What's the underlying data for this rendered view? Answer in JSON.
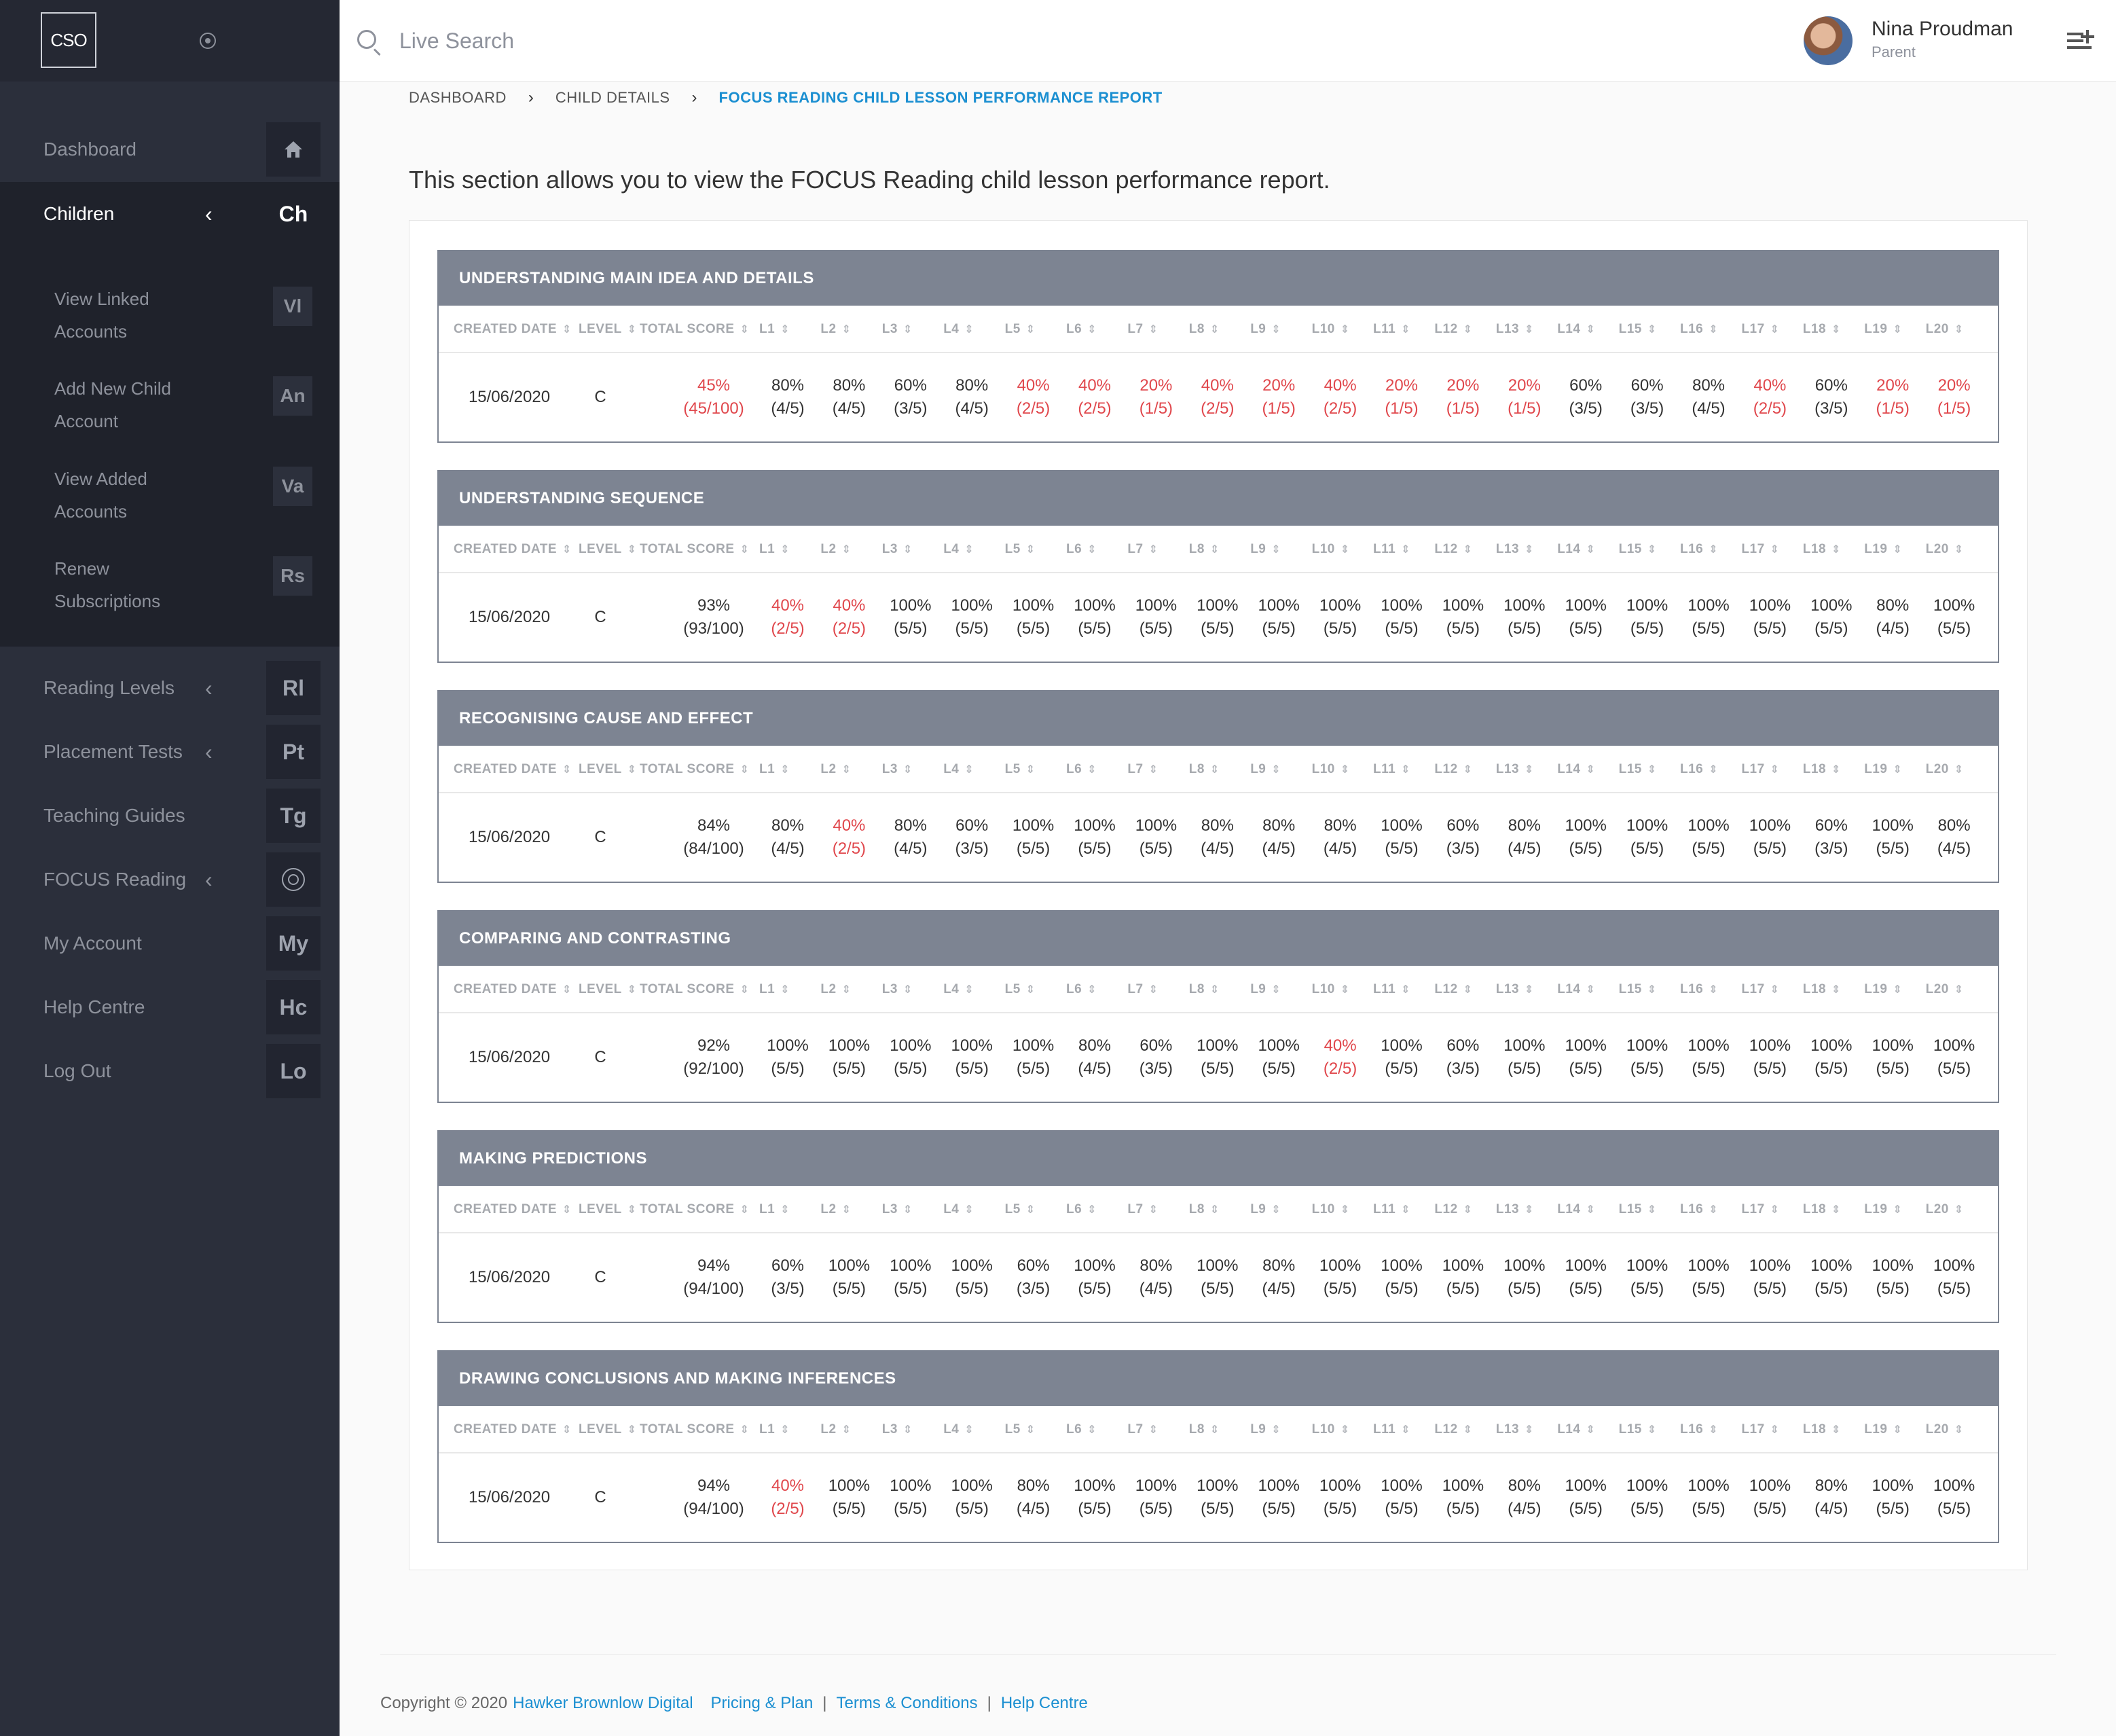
{
  "brand": {
    "logo_text": "CSO"
  },
  "icons": {
    "pin": "pin-icon",
    "search": "search-icon",
    "add": "add-user-icon",
    "target": "target-icon"
  },
  "colors": {
    "accent": "#1b8fd1",
    "low_score": "#e0474c",
    "section_header": "#7d8492",
    "sidebar": "#2b2f3b"
  },
  "sidebar": {
    "items": [
      {
        "label": "Dashboard",
        "abbr": ""
      },
      {
        "label": "Children",
        "abbr": "Ch",
        "chevron": "‹"
      },
      {
        "label": "Reading Levels",
        "abbr": "Rl",
        "chevron": "‹"
      },
      {
        "label": "Placement Tests",
        "abbr": "Pt",
        "chevron": "‹"
      },
      {
        "label": "Teaching Guides",
        "abbr": "Tg"
      },
      {
        "label": "FOCUS Reading",
        "abbr": "",
        "chevron": "‹"
      },
      {
        "label": "My Account",
        "abbr": "My"
      },
      {
        "label": "Help Centre",
        "abbr": "Hc"
      },
      {
        "label": "Log Out",
        "abbr": "Lo"
      }
    ],
    "children_sub": [
      {
        "line1": "View Linked",
        "line2": "Accounts",
        "abbr": "Vl"
      },
      {
        "line1": "Add New Child",
        "line2": "Account",
        "abbr": "An"
      },
      {
        "line1": "View Added",
        "line2": "Accounts",
        "abbr": "Va"
      },
      {
        "line1": "Renew",
        "line2": "Subscriptions",
        "abbr": "Rs"
      }
    ]
  },
  "header": {
    "search_placeholder": "Live Search",
    "user_name": "Nina Proudman",
    "user_role": "Parent"
  },
  "breadcrumb": [
    "DASHBOARD",
    "CHILD DETAILS",
    "FOCUS READING CHILD LESSON PERFORMANCE REPORT"
  ],
  "intro": "This section allows you to view the FOCUS Reading child lesson performance report.",
  "table_columns": [
    "CREATED DATE",
    "LEVEL",
    "TOTAL SCORE",
    "L1",
    "L2",
    "L3",
    "L4",
    "L5",
    "L6",
    "L7",
    "L8",
    "L9",
    "L10",
    "L11",
    "L12",
    "L13",
    "L14",
    "L15",
    "L16",
    "L17",
    "L18",
    "L19",
    "L20"
  ],
  "sections": [
    {
      "title": "UNDERSTANDING MAIN IDEA AND DETAILS",
      "date": "15/06/2020",
      "level": "C",
      "total": {
        "pct": "45%",
        "raw": "(45/100)",
        "low": true
      },
      "lessons": [
        [
          "80%",
          "(4/5)"
        ],
        [
          "80%",
          "(4/5)"
        ],
        [
          "60%",
          "(3/5)"
        ],
        [
          "80%",
          "(4/5)"
        ],
        [
          "40%",
          "(2/5)"
        ],
        [
          "40%",
          "(2/5)"
        ],
        [
          "20%",
          "(1/5)"
        ],
        [
          "40%",
          "(2/5)"
        ],
        [
          "20%",
          "(1/5)"
        ],
        [
          "40%",
          "(2/5)"
        ],
        [
          "20%",
          "(1/5)"
        ],
        [
          "20%",
          "(1/5)"
        ],
        [
          "20%",
          "(1/5)"
        ],
        [
          "60%",
          "(3/5)"
        ],
        [
          "60%",
          "(3/5)"
        ],
        [
          "80%",
          "(4/5)"
        ],
        [
          "40%",
          "(2/5)"
        ],
        [
          "60%",
          "(3/5)"
        ],
        [
          "20%",
          "(1/5)"
        ],
        [
          "20%",
          "(1/5)"
        ]
      ]
    },
    {
      "title": "UNDERSTANDING SEQUENCE",
      "date": "15/06/2020",
      "level": "C",
      "total": {
        "pct": "93%",
        "raw": "(93/100)",
        "low": false
      },
      "lessons": [
        [
          "40%",
          "(2/5)"
        ],
        [
          "40%",
          "(2/5)"
        ],
        [
          "100%",
          "(5/5)"
        ],
        [
          "100%",
          "(5/5)"
        ],
        [
          "100%",
          "(5/5)"
        ],
        [
          "100%",
          "(5/5)"
        ],
        [
          "100%",
          "(5/5)"
        ],
        [
          "100%",
          "(5/5)"
        ],
        [
          "100%",
          "(5/5)"
        ],
        [
          "100%",
          "(5/5)"
        ],
        [
          "100%",
          "(5/5)"
        ],
        [
          "100%",
          "(5/5)"
        ],
        [
          "100%",
          "(5/5)"
        ],
        [
          "100%",
          "(5/5)"
        ],
        [
          "100%",
          "(5/5)"
        ],
        [
          "100%",
          "(5/5)"
        ],
        [
          "100%",
          "(5/5)"
        ],
        [
          "100%",
          "(5/5)"
        ],
        [
          "80%",
          "(4/5)"
        ],
        [
          "100%",
          "(5/5)"
        ]
      ]
    },
    {
      "title": "RECOGNISING CAUSE AND EFFECT",
      "date": "15/06/2020",
      "level": "C",
      "total": {
        "pct": "84%",
        "raw": "(84/100)",
        "low": false
      },
      "lessons": [
        [
          "80%",
          "(4/5)"
        ],
        [
          "40%",
          "(2/5)"
        ],
        [
          "80%",
          "(4/5)"
        ],
        [
          "60%",
          "(3/5)"
        ],
        [
          "100%",
          "(5/5)"
        ],
        [
          "100%",
          "(5/5)"
        ],
        [
          "100%",
          "(5/5)"
        ],
        [
          "80%",
          "(4/5)"
        ],
        [
          "80%",
          "(4/5)"
        ],
        [
          "80%",
          "(4/5)"
        ],
        [
          "100%",
          "(5/5)"
        ],
        [
          "60%",
          "(3/5)"
        ],
        [
          "80%",
          "(4/5)"
        ],
        [
          "100%",
          "(5/5)"
        ],
        [
          "100%",
          "(5/5)"
        ],
        [
          "100%",
          "(5/5)"
        ],
        [
          "100%",
          "(5/5)"
        ],
        [
          "60%",
          "(3/5)"
        ],
        [
          "100%",
          "(5/5)"
        ],
        [
          "80%",
          "(4/5)"
        ]
      ]
    },
    {
      "title": "COMPARING AND CONTRASTING",
      "date": "15/06/2020",
      "level": "C",
      "total": {
        "pct": "92%",
        "raw": "(92/100)",
        "low": false
      },
      "lessons": [
        [
          "100%",
          "(5/5)"
        ],
        [
          "100%",
          "(5/5)"
        ],
        [
          "100%",
          "(5/5)"
        ],
        [
          "100%",
          "(5/5)"
        ],
        [
          "100%",
          "(5/5)"
        ],
        [
          "80%",
          "(4/5)"
        ],
        [
          "60%",
          "(3/5)"
        ],
        [
          "100%",
          "(5/5)"
        ],
        [
          "100%",
          "(5/5)"
        ],
        [
          "40%",
          "(2/5)"
        ],
        [
          "100%",
          "(5/5)"
        ],
        [
          "60%",
          "(3/5)"
        ],
        [
          "100%",
          "(5/5)"
        ],
        [
          "100%",
          "(5/5)"
        ],
        [
          "100%",
          "(5/5)"
        ],
        [
          "100%",
          "(5/5)"
        ],
        [
          "100%",
          "(5/5)"
        ],
        [
          "100%",
          "(5/5)"
        ],
        [
          "100%",
          "(5/5)"
        ],
        [
          "100%",
          "(5/5)"
        ]
      ]
    },
    {
      "title": "MAKING PREDICTIONS",
      "date": "15/06/2020",
      "level": "C",
      "total": {
        "pct": "94%",
        "raw": "(94/100)",
        "low": false
      },
      "lessons": [
        [
          "60%",
          "(3/5)"
        ],
        [
          "100%",
          "(5/5)"
        ],
        [
          "100%",
          "(5/5)"
        ],
        [
          "100%",
          "(5/5)"
        ],
        [
          "60%",
          "(3/5)"
        ],
        [
          "100%",
          "(5/5)"
        ],
        [
          "80%",
          "(4/5)"
        ],
        [
          "100%",
          "(5/5)"
        ],
        [
          "80%",
          "(4/5)"
        ],
        [
          "100%",
          "(5/5)"
        ],
        [
          "100%",
          "(5/5)"
        ],
        [
          "100%",
          "(5/5)"
        ],
        [
          "100%",
          "(5/5)"
        ],
        [
          "100%",
          "(5/5)"
        ],
        [
          "100%",
          "(5/5)"
        ],
        [
          "100%",
          "(5/5)"
        ],
        [
          "100%",
          "(5/5)"
        ],
        [
          "100%",
          "(5/5)"
        ],
        [
          "100%",
          "(5/5)"
        ],
        [
          "100%",
          "(5/5)"
        ]
      ]
    },
    {
      "title": "DRAWING CONCLUSIONS AND MAKING INFERENCES",
      "date": "15/06/2020",
      "level": "C",
      "total": {
        "pct": "94%",
        "raw": "(94/100)",
        "low": false
      },
      "lessons": [
        [
          "40%",
          "(2/5)"
        ],
        [
          "100%",
          "(5/5)"
        ],
        [
          "100%",
          "(5/5)"
        ],
        [
          "100%",
          "(5/5)"
        ],
        [
          "80%",
          "(4/5)"
        ],
        [
          "100%",
          "(5/5)"
        ],
        [
          "100%",
          "(5/5)"
        ],
        [
          "100%",
          "(5/5)"
        ],
        [
          "100%",
          "(5/5)"
        ],
        [
          "100%",
          "(5/5)"
        ],
        [
          "100%",
          "(5/5)"
        ],
        [
          "100%",
          "(5/5)"
        ],
        [
          "80%",
          "(4/5)"
        ],
        [
          "100%",
          "(5/5)"
        ],
        [
          "100%",
          "(5/5)"
        ],
        [
          "100%",
          "(5/5)"
        ],
        [
          "100%",
          "(5/5)"
        ],
        [
          "80%",
          "(4/5)"
        ],
        [
          "100%",
          "(5/5)"
        ],
        [
          "100%",
          "(5/5)"
        ]
      ]
    }
  ],
  "footer": {
    "copyright": "Copyright © 2020",
    "company": "Hawker Brownlow Digital",
    "links": [
      "Pricing & Plan",
      "Terms & Conditions",
      "Help Centre"
    ]
  }
}
